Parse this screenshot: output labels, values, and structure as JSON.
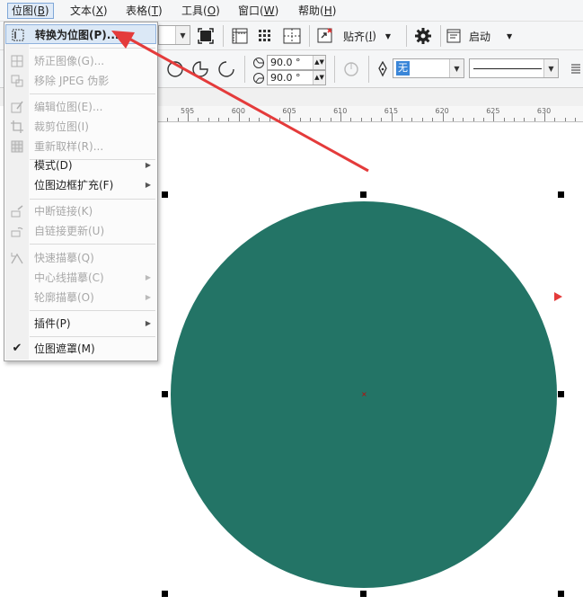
{
  "menubar": {
    "items": [
      {
        "label": "位图(",
        "key": "B",
        "tail": ")"
      },
      {
        "label": "文本(",
        "key": "X",
        "tail": ")"
      },
      {
        "label": "表格(",
        "key": "T",
        "tail": ")"
      },
      {
        "label": "工具(",
        "key": "O",
        "tail": ")"
      },
      {
        "label": "窗口(",
        "key": "W",
        "tail": ")"
      },
      {
        "label": "帮助(",
        "key": "H",
        "tail": ")"
      }
    ]
  },
  "toolbar": {
    "snap_label": "贴齐(",
    "snap_key": "I",
    "snap_tail": ")",
    "launch_label": "启动"
  },
  "property_bar": {
    "angle_start": "90.0 °",
    "angle_end": "90.0 °",
    "outline_width": "无"
  },
  "ruler": {
    "labels": [
      "595",
      "600",
      "605",
      "610",
      "615",
      "620",
      "625",
      "630"
    ]
  },
  "dropdown": {
    "items": [
      {
        "label": "转换为位图(P)...",
        "enabled": true,
        "highlight": true,
        "icon": "convert-to-bitmap-icon"
      },
      {
        "label": "矫正图像(G)...",
        "enabled": false,
        "icon": "straighten-image-icon"
      },
      {
        "label": "移除 JPEG 伪影",
        "enabled": false,
        "icon": "remove-jpeg-artifacts-icon"
      },
      {
        "label": "编辑位图(E)...",
        "enabled": false,
        "icon": "edit-bitmap-icon"
      },
      {
        "label": "裁剪位图(I)",
        "enabled": false,
        "icon": "crop-bitmap-icon"
      },
      {
        "label": "重新取样(R)...",
        "enabled": false,
        "icon": "resample-icon"
      },
      {
        "label": "模式(D)",
        "enabled": true,
        "submenu": true
      },
      {
        "label": "位图边框扩充(F)",
        "enabled": true,
        "submenu": true
      },
      {
        "label": "中断链接(K)",
        "enabled": false,
        "icon": "break-link-icon"
      },
      {
        "label": "自链接更新(U)",
        "enabled": false,
        "icon": "update-link-icon"
      },
      {
        "label": "快速描摹(Q)",
        "enabled": false,
        "icon": "quick-trace-icon"
      },
      {
        "label": "中心线描摹(C)",
        "enabled": false,
        "submenu": true
      },
      {
        "label": "轮廓描摹(O)",
        "enabled": false,
        "submenu": true
      },
      {
        "label": "插件(P)",
        "enabled": true,
        "submenu": true
      },
      {
        "label": "位图遮罩(M)",
        "enabled": true,
        "checked": true
      }
    ]
  },
  "colors": {
    "circle_fill": "#237466",
    "arrow": "#e43b3b",
    "highlight": "#dbe8f6"
  }
}
